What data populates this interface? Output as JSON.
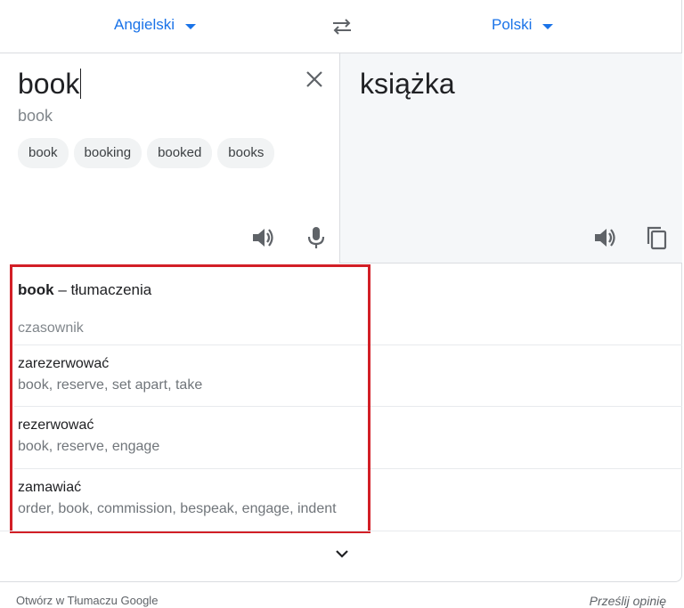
{
  "header": {
    "source_lang": "Angielski",
    "target_lang": "Polski"
  },
  "source": {
    "text": "book",
    "transliteration": "book",
    "suggestions": [
      "book",
      "booking",
      "booked",
      "books"
    ]
  },
  "target": {
    "text": "książka"
  },
  "dictionary": {
    "word": "book",
    "heading_suffix": " – tłumaczenia",
    "part_of_speech": "czasownik",
    "entries": [
      {
        "word": "zarezerwować",
        "synonyms": "book, reserve, set apart, take"
      },
      {
        "word": "rezerwować",
        "synonyms": "book, reserve, engage"
      },
      {
        "word": "zamawiać",
        "synonyms": "order, book, commission, bespeak, engage, indent"
      }
    ]
  },
  "footer": {
    "open_link": "Otwórz w Tłumaczu Google",
    "feedback": "Prześlij opinię"
  },
  "icons": {
    "swap": "swap-arrows-icon",
    "clear": "close-icon",
    "speaker": "speaker-icon",
    "mic": "microphone-icon",
    "copy": "copy-icon",
    "expand": "chevron-down-icon"
  },
  "colors": {
    "accent": "#1a73e8",
    "highlight_border": "#d21f26"
  }
}
